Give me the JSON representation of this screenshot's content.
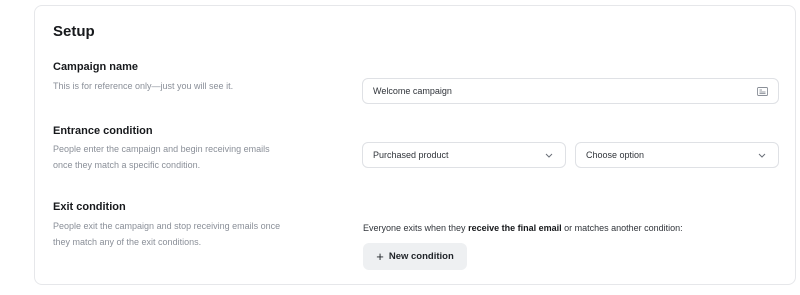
{
  "setup": {
    "title": "Setup",
    "campaign_name": {
      "label": "Campaign name",
      "description": "This is for reference only—just you will see it.",
      "value": "Welcome campaign",
      "icon": "id-card-icon"
    },
    "entrance": {
      "label": "Entrance condition",
      "description": "People enter the campaign and begin receiving emails once they match a specific condition.",
      "condition_value": "Purchased product",
      "option_value": "Choose option"
    },
    "exit": {
      "label": "Exit condition",
      "description": "People exit the campaign and stop receiving emails once they match any of the exit conditions.",
      "text_before": "Everyone exits when they ",
      "text_bold": "receive the final email",
      "text_after": " or matches another condition:",
      "button_label": "New condition"
    }
  }
}
